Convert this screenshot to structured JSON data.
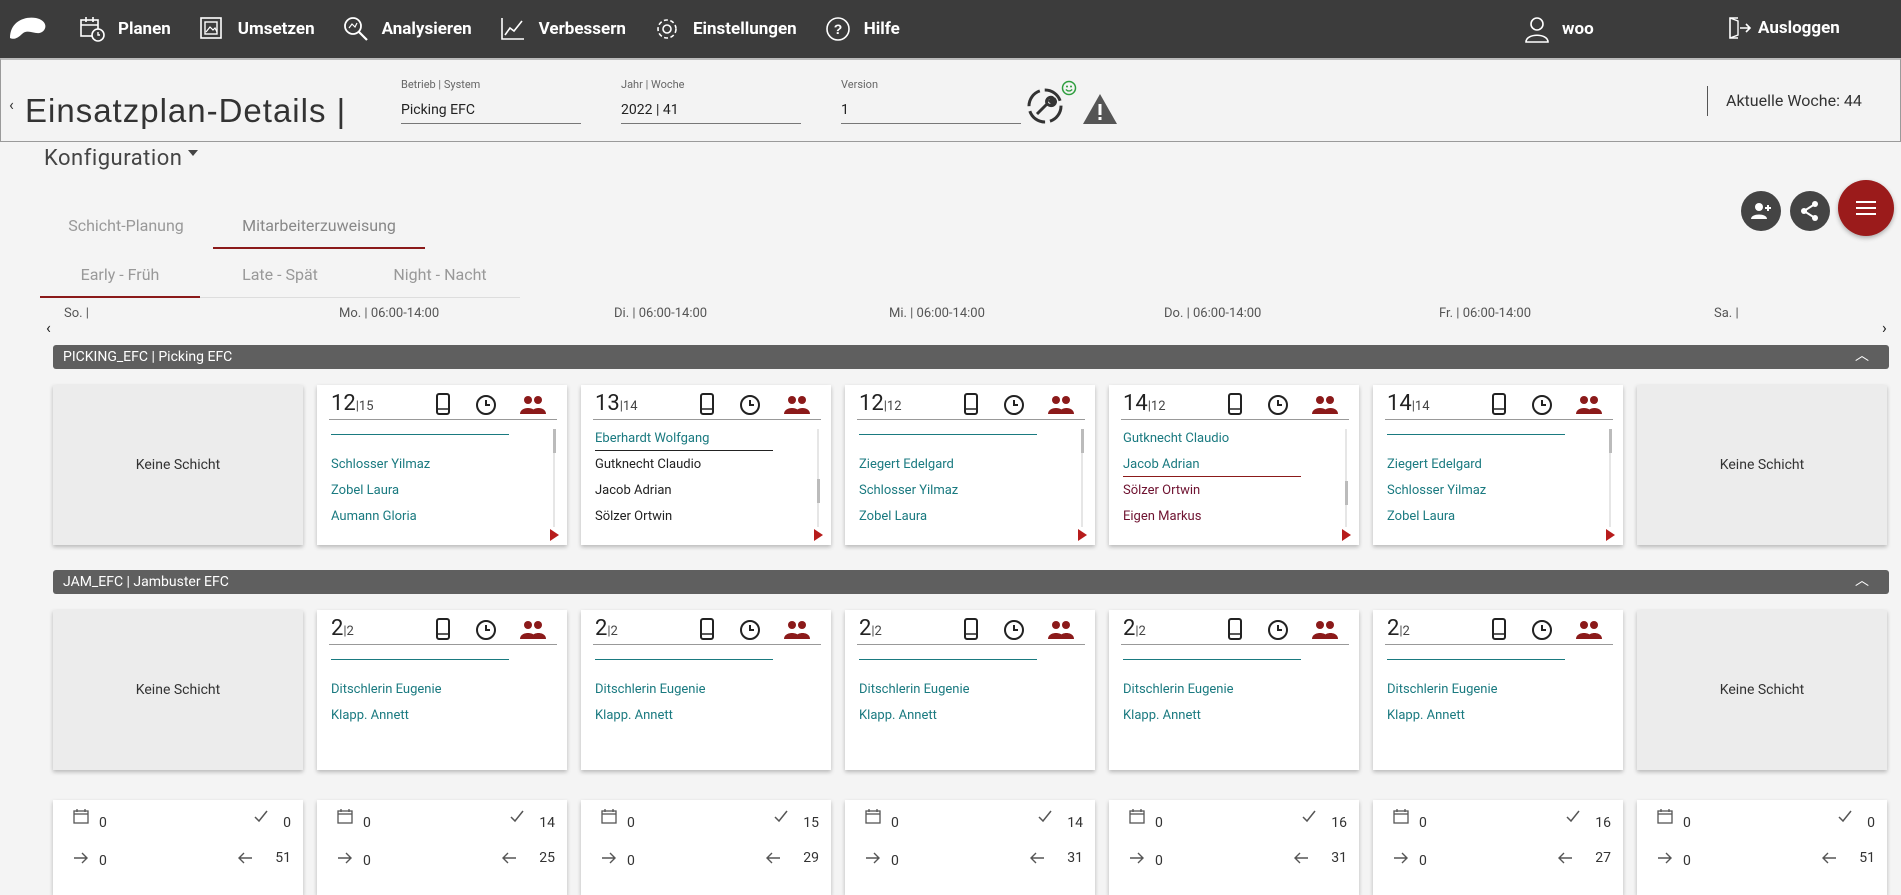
{
  "nav": {
    "items": [
      {
        "label": "Planen",
        "icon": "calendar-clock-icon"
      },
      {
        "label": "Umsetzen",
        "icon": "image-stack-icon"
      },
      {
        "label": "Analysieren",
        "icon": "magnifier-icon"
      },
      {
        "label": "Verbessern",
        "icon": "trend-chart-icon"
      },
      {
        "label": "Einstellungen",
        "icon": "gear-icon"
      },
      {
        "label": "Hilfe",
        "icon": "question-icon"
      }
    ],
    "user": "woo",
    "logout": "Ausloggen"
  },
  "header": {
    "back": "‹",
    "title": "Einsatzplan-Details |",
    "fields": [
      {
        "label": "Betrieb | System",
        "value": "Picking EFC"
      },
      {
        "label": "Jahr | Woche",
        "value": "2022 | 41"
      },
      {
        "label": "Version",
        "value": "1"
      }
    ],
    "current_week": "Aktuelle Woche: 44"
  },
  "config": {
    "label": "Konfiguration"
  },
  "tabs": {
    "main": [
      "Schicht-Planung",
      "Mitarbeiterzuweisung"
    ],
    "shifts": [
      "Early - Früh",
      "Late - Spät",
      "Night - Nacht"
    ]
  },
  "days": [
    "So. |",
    "Mo. | 06:00-14:00",
    "Di. | 06:00-14:00",
    "Mi. | 06:00-14:00",
    "Do. | 06:00-14:00",
    "Fr. | 06:00-14:00",
    "Sa. |"
  ],
  "no_shift": "Keine Schicht",
  "groups": [
    {
      "title": "PICKING_EFC | Picking EFC",
      "cards": [
        {
          "count": "12",
          "of": "|15",
          "names": [
            "",
            "Schlosser Yilmaz",
            "Zobel Laura",
            "Aumann Gloria"
          ]
        },
        {
          "count": "13",
          "of": "|14",
          "names": [
            "Eberhardt Wolfgang",
            "Gutknecht Claudio",
            "Jacob Adrian",
            "Sölzer Ortwin"
          ]
        },
        {
          "count": "12",
          "of": "|12",
          "names": [
            "",
            "Ziegert Edelgard",
            "Schlosser Yilmaz",
            "Zobel Laura"
          ]
        },
        {
          "count": "14",
          "of": "|12",
          "names": [
            "Gutknecht Claudio",
            "Jacob Adrian",
            "Sölzer Ortwin",
            "Eigen Markus"
          ]
        },
        {
          "count": "14",
          "of": "|14",
          "names": [
            "",
            "Ziegert Edelgard",
            "Schlosser Yilmaz",
            "Zobel Laura"
          ]
        }
      ]
    },
    {
      "title": "JAM_EFC | Jambuster EFC",
      "cards": [
        {
          "count": "2",
          "of": "|2",
          "names": [
            "",
            "Ditschlerin Eugenie",
            "Klapp. Annett"
          ]
        },
        {
          "count": "2",
          "of": "|2",
          "names": [
            "",
            "Ditschlerin Eugenie",
            "Klapp. Annett"
          ]
        },
        {
          "count": "2",
          "of": "|2",
          "names": [
            "",
            "Ditschlerin Eugenie",
            "Klapp. Annett"
          ]
        },
        {
          "count": "2",
          "of": "|2",
          "names": [
            "",
            "Ditschlerin Eugenie",
            "Klapp. Annett"
          ]
        },
        {
          "count": "2",
          "of": "|2",
          "names": [
            "",
            "Ditschlerin Eugenie",
            "Klapp. Annett"
          ]
        }
      ]
    }
  ],
  "stats": [
    {
      "cal": "0",
      "check": "0",
      "in": "0",
      "out": "51"
    },
    {
      "cal": "0",
      "check": "14",
      "in": "0",
      "out": "25"
    },
    {
      "cal": "0",
      "check": "15",
      "in": "0",
      "out": "29"
    },
    {
      "cal": "0",
      "check": "14",
      "in": "0",
      "out": "31"
    },
    {
      "cal": "0",
      "check": "16",
      "in": "0",
      "out": "31"
    },
    {
      "cal": "0",
      "check": "16",
      "in": "0",
      "out": "27"
    },
    {
      "cal": "0",
      "check": "0",
      "in": "0",
      "out": "51"
    }
  ],
  "colors": {
    "accent": "#8b1a1a",
    "teal": "#1a7a80",
    "maroon": "#6e1230",
    "topbar": "#3c3c3c"
  }
}
